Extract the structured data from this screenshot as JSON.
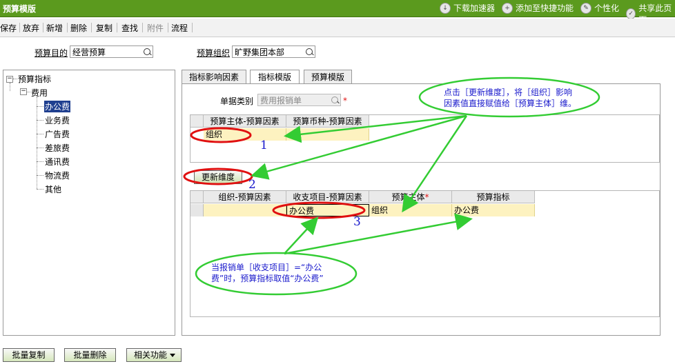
{
  "window": {
    "title": "预算模版"
  },
  "titlebar_links": [
    {
      "label": "下载加速器",
      "icon": "download-icon"
    },
    {
      "label": "添加至快捷功能",
      "icon": "add-shortcut-icon"
    },
    {
      "label": "个性化",
      "icon": "personalize-icon"
    },
    {
      "label": "共享此页面",
      "icon": "share-icon"
    }
  ],
  "toolbar": {
    "items": [
      "保存",
      "放弃",
      "新增",
      "删除",
      "复制",
      "查找",
      "附件",
      "流程"
    ]
  },
  "form": {
    "purpose_label": "预算目的",
    "purpose_value": "经营预算",
    "org_label": "预算组织",
    "org_value": "旷野集团本部"
  },
  "tree": {
    "root": "预算指标",
    "group": "费用",
    "items": [
      "办公费",
      "业务费",
      "广告费",
      "差旅费",
      "通讯费",
      "物流费",
      "其他"
    ],
    "selected": "办公费"
  },
  "tabs": [
    "指标影响因素",
    "指标模版",
    "预算模版"
  ],
  "active_tab": "指标模版",
  "doc_type": {
    "label": "单据类别",
    "value": "费用报销单"
  },
  "grid1": {
    "headers": [
      "预算主体-预算因素",
      "预算币种-预算因素"
    ],
    "rows": [
      [
        "组织",
        ""
      ]
    ]
  },
  "update_button": "更新维度",
  "grid2": {
    "headers": [
      "组织-预算因素",
      "收支项目-预算因素",
      "预算主体",
      "预算指标"
    ],
    "required_mark": "*",
    "rows": [
      [
        "",
        "办公费",
        "组织",
        "办公费"
      ]
    ]
  },
  "annotations": {
    "top_note_line1": "点击［更新维度］，将［组织］影响",
    "top_note_line2": "因素值直接赋值给［预算主体］维。",
    "bottom_note_line1": "当报销单［收支项目］=“办公",
    "bottom_note_line2": "费”时，预算指标取值“办公费”",
    "marker1": "1",
    "marker2": "2",
    "marker3": "3",
    "highlight_color": "#e01010",
    "callout_color": "#33cc33"
  },
  "bottom_buttons": [
    "批量复制",
    "批量删除",
    "相关功能"
  ]
}
